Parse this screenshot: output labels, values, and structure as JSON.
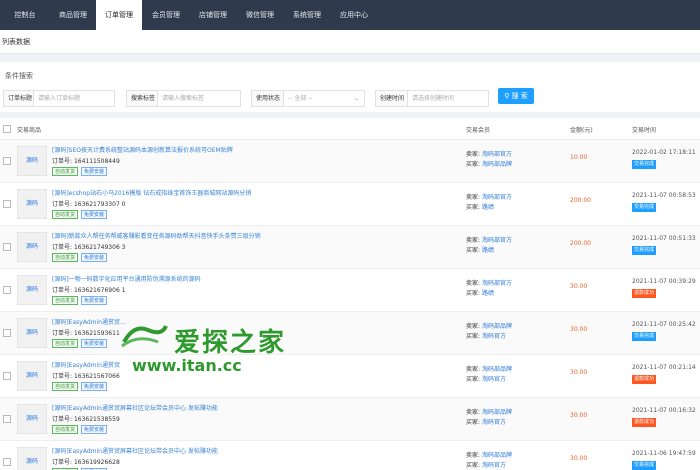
{
  "nav": {
    "items": [
      {
        "label": "控制台",
        "active": false
      },
      {
        "label": "商品管理",
        "active": false
      },
      {
        "label": "订单管理",
        "active": true
      },
      {
        "label": "会员管理",
        "active": false
      },
      {
        "label": "店铺管理",
        "active": false
      },
      {
        "label": "微信管理",
        "active": false
      },
      {
        "label": "系统管理",
        "active": false
      },
      {
        "label": "应用中心",
        "active": false
      }
    ]
  },
  "page": {
    "title": "列表数据"
  },
  "filter": {
    "title": "条件搜索",
    "order_title_label": "订单标题",
    "order_title_placeholder": "请输入订单标题",
    "search_tag_label": "搜索标签",
    "search_tag_placeholder": "请输入搜索标签",
    "status_label": "使用状态",
    "status_value": "-- 全部 --",
    "created_label": "创建时间",
    "created_placeholder": "请选择创建时间",
    "search_button": "搜 索"
  },
  "table": {
    "headers": {
      "product": "交易商品",
      "member": "交易会员",
      "amount": "金额(元)",
      "time": "交易时间"
    },
    "seller_label": "卖家:",
    "buyer_label": "买家:",
    "order_no_label": "订单号:",
    "thumb_label": "源码",
    "rows": [
      {
        "title": "[源码]SEO按天计费系统整站源码本源创新算法报价系统可OEM贴牌",
        "order_no": "164111508449",
        "tags": [
          "自动发货",
          "免费安装"
        ],
        "seller": "淘码部官方",
        "buyer": "淘码部品牌",
        "amount": "10.00",
        "time": "2022-01-02 17:18:11",
        "status": "交易完成",
        "status_type": "done"
      },
      {
        "title": "[源码]ecshop站石小马2016模版 钻石戒指珠宝首饰王器商城网站源码分销",
        "order_no": "163621793307 0",
        "tags": [
          "自动发货",
          "免费安装"
        ],
        "seller": "淘码部官方",
        "buyer": "路绩",
        "amount": "200.00",
        "time": "2021-11-07 00:58:53",
        "status": "交易完成",
        "status_type": "done"
      },
      {
        "title": "[源码]新款众人帮任务帮威客赚影看变任务源码助帮天抖音快手头条赞三级分销",
        "order_no": "163621749306 3",
        "tags": [
          "自动发货",
          "免费安装"
        ],
        "seller": "淘码部官方",
        "buyer": "路绩",
        "amount": "200.00",
        "time": "2021-11-07 00:51:33",
        "status": "交易完成",
        "status_type": "done"
      },
      {
        "title": "[源码]一物一码数字化应用平台通用防伪溯源系统的源码",
        "order_no": "163621676906 1",
        "tags": [
          "自动发货",
          "免费安装"
        ],
        "seller": "淘码部官方",
        "buyer": "路绩",
        "amount": "30.00",
        "time": "2021-11-07 00:39:29",
        "status": "退款成功",
        "status_type": "refund"
      },
      {
        "title": "[源码]EasyAdmin通赏贸...",
        "order_no": "163621593611",
        "tags": [
          "自动发货",
          "免费安装"
        ],
        "seller": "淘码部品牌",
        "buyer": "淘码官方",
        "amount": "30.00",
        "time": "2021-11-07 00:25:42",
        "status": "交易完成",
        "status_type": "done"
      },
      {
        "title": "[源码]EasyAdmin通赏贸",
        "order_no": "163621567066",
        "tags": [
          "自动发货",
          "免费安装"
        ],
        "seller": "淘码部品牌",
        "buyer": "淘码官方",
        "amount": "30.00",
        "time": "2021-11-07 00:21:14",
        "status": "退款成功",
        "status_type": "refund"
      },
      {
        "title": "[源码]EasyAdmin通赏贸屏幕社区论坛带会员中心 发帖赚功能",
        "order_no": "163621538559",
        "tags": [
          "自动发货",
          "免费安装"
        ],
        "seller": "淘码部品牌",
        "buyer": "淘码官方",
        "amount": "30.00",
        "time": "2021-11-07 00:16:32",
        "status": "退款成功",
        "status_type": "refund"
      },
      {
        "title": "[源码]EasyAdmin通赏贸屏幕社区论坛带会员中心 发帖赚功能",
        "order_no": "163619926628",
        "tags": [
          "自动发货",
          "免费安装"
        ],
        "seller": "淘码部品牌",
        "buyer": "淘码官方",
        "amount": "30.00",
        "time": "2021-11-06 19:47:59",
        "status": "交易完成",
        "status_type": "done"
      }
    ]
  },
  "watermark": {
    "cn": "爱探之家",
    "en": "www.itan.cc"
  }
}
